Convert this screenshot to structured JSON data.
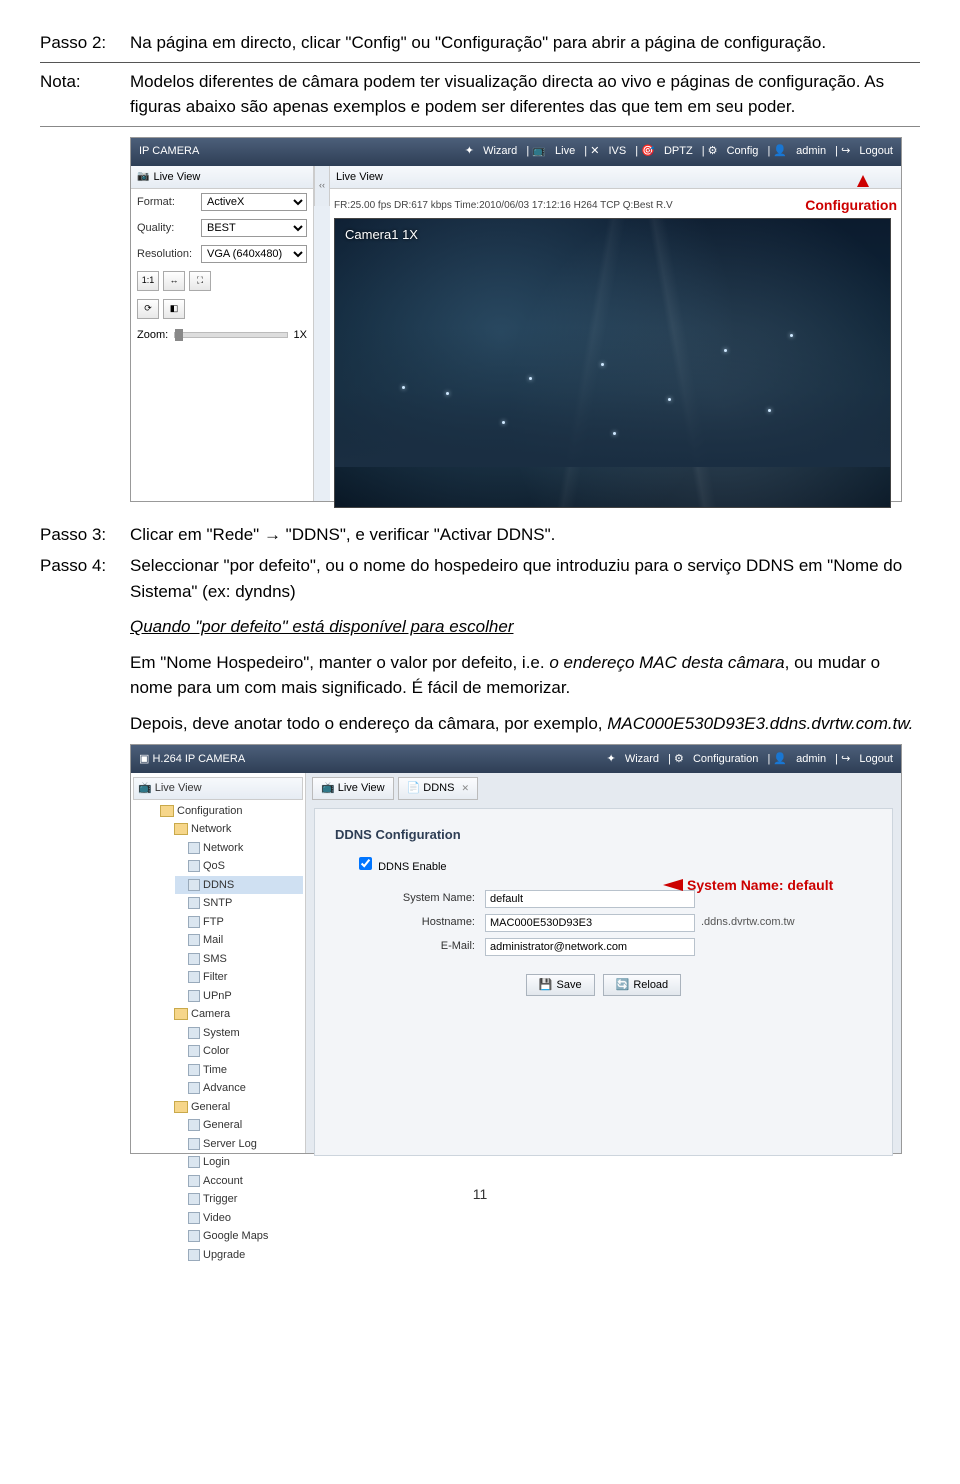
{
  "steps": {
    "p2": {
      "label": "Passo 2:",
      "text": "Na página em directo, clicar \"Config\" ou \"Configuração\" para abrir a página de configuração."
    },
    "nota": {
      "label": "Nota:",
      "text": "Modelos diferentes de câmara podem ter visualização directa ao vivo e páginas de configuração. As figuras abaixo são apenas exemplos e podem ser diferentes das que tem em seu poder."
    },
    "p3": {
      "label": "Passo 3:",
      "text": "Clicar em \"Rede\" → \"DDNS\", e verificar \"Activar DDNS\"."
    },
    "p4": {
      "label": "Passo 4:",
      "line1": "Seleccionar \"por defeito\", ou o nome do hospedeiro que introduziu para o serviço DDNS em \"Nome do Sistema\" (ex: dyndns)",
      "line2": "Quando \"por defeito\" está disponível para escolher",
      "line3a": "Em \"Nome Hospedeiro\", manter o valor por defeito, i.e. ",
      "line3b": "o endereço MAC desta câmara",
      "line3c": ", ou mudar o nome para um com mais significado. É fácil de memorizar.",
      "line4a": "Depois, deve anotar todo o endereço da câmara, por exemplo, ",
      "line4b": "MAC000E530D93E3.ddns.dvrtw.com.tw."
    }
  },
  "shot1": {
    "title": "IP CAMERA",
    "nav": {
      "wizard": "Wizard",
      "live": "Live",
      "ivs": "IVS",
      "dptz": "DPTZ",
      "config": "Config",
      "admin": "admin",
      "logout": "Logout"
    },
    "side": {
      "tab": "Live View",
      "format_l": "Format:",
      "format_v": "ActiveX",
      "quality_l": "Quality:",
      "quality_v": "BEST",
      "res_l": "Resolution:",
      "res_v": "VGA (640x480)",
      "icons": [
        "1:1",
        "↔",
        "⛶"
      ],
      "icons2": [
        "⟳",
        "◧"
      ],
      "zoom_l": "Zoom:",
      "zoom_v": "1X"
    },
    "collapse": "‹‹",
    "main_tab": "Live View",
    "info": "FR:25.00 fps DR:617 kbps Time:2010/06/03 17:12:16 H264 TCP Q:Best R.V",
    "callout": "Configuration",
    "camname": "Camera1 1X"
  },
  "shot2": {
    "title": "H.264 IP CAMERA",
    "nav": {
      "wizard": "Wizard",
      "config": "Configuration",
      "admin": "admin",
      "logout": "Logout"
    },
    "tree": {
      "live": "Live View",
      "configuration": "Configuration",
      "network": "Network",
      "items_net": [
        "Network",
        "QoS",
        "DDNS",
        "SNTP",
        "FTP",
        "Mail",
        "SMS",
        "Filter",
        "UPnP"
      ],
      "camera": "Camera",
      "items_cam": [
        "System",
        "Color",
        "Time",
        "Advance"
      ],
      "general": "General",
      "items_gen": [
        "General",
        "Server Log",
        "Login",
        "Account",
        "Trigger",
        "Video",
        "Google Maps",
        "Upgrade"
      ]
    },
    "tabs": {
      "live": "Live View",
      "ddns": "DDNS"
    },
    "panel": {
      "title": "DDNS Configuration",
      "enable": "DDNS Enable",
      "sys_l": "System Name:",
      "sys_v": "default",
      "host_l": "Hostname:",
      "host_v": "MAC000E530D93E3",
      "host_suffix": ".ddns.dvrtw.com.tw",
      "mail_l": "E-Mail:",
      "mail_v": "administrator@network.com",
      "save": "Save",
      "reload": "Reload",
      "callout": "System Name: default"
    }
  },
  "page": "11"
}
